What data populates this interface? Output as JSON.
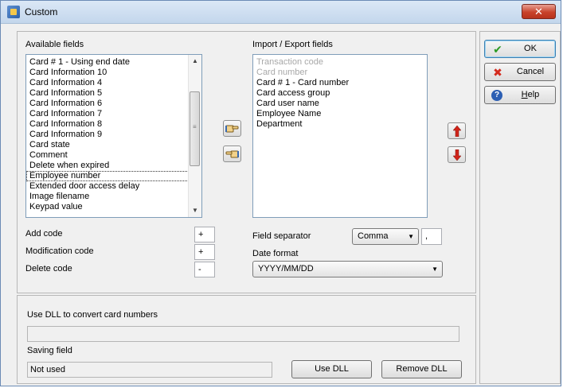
{
  "window": {
    "title": "Custom",
    "close_glyph": "✕"
  },
  "available": {
    "label": "Available fields",
    "items": [
      "Card # 1 - Using end date",
      "Card Information 10",
      "Card Information 4",
      "Card Information 5",
      "Card Information 6",
      "Card Information 7",
      "Card Information 8",
      "Card Information 9",
      "Card state",
      "Comment",
      "Delete when expired",
      "Employee number",
      "Extended door access delay",
      "Image filename",
      "Keypad value"
    ]
  },
  "importexport": {
    "label": "Import / Export fields",
    "items": [
      "Transaction code",
      "Card number",
      "Card # 1 - Card number",
      "Card access group",
      "Card user name",
      "Employee Name",
      "Department"
    ]
  },
  "codes": {
    "add_label": "Add code",
    "add_value": "+",
    "mod_label": "Modification code",
    "mod_value": "+",
    "del_label": "Delete code",
    "del_value": "-"
  },
  "separator": {
    "label": "Field separator",
    "value": "Comma",
    "char": ","
  },
  "dateformat": {
    "label": "Date format",
    "value": "YYYY/MM/DD"
  },
  "dll": {
    "label": "Use DLL to convert card numbers",
    "path_value": "",
    "saving_label": "Saving field",
    "saving_value": "Not used",
    "use_button": "Use DLL",
    "remove_button": "Remove DLL"
  },
  "buttons": {
    "ok": "OK",
    "cancel": "Cancel",
    "help": "Help"
  },
  "colors": {
    "accent": "#3c7fb1",
    "ok_green": "#2a9a23",
    "cancel_red": "#d42a1d",
    "arrow_red": "#d0241a"
  }
}
